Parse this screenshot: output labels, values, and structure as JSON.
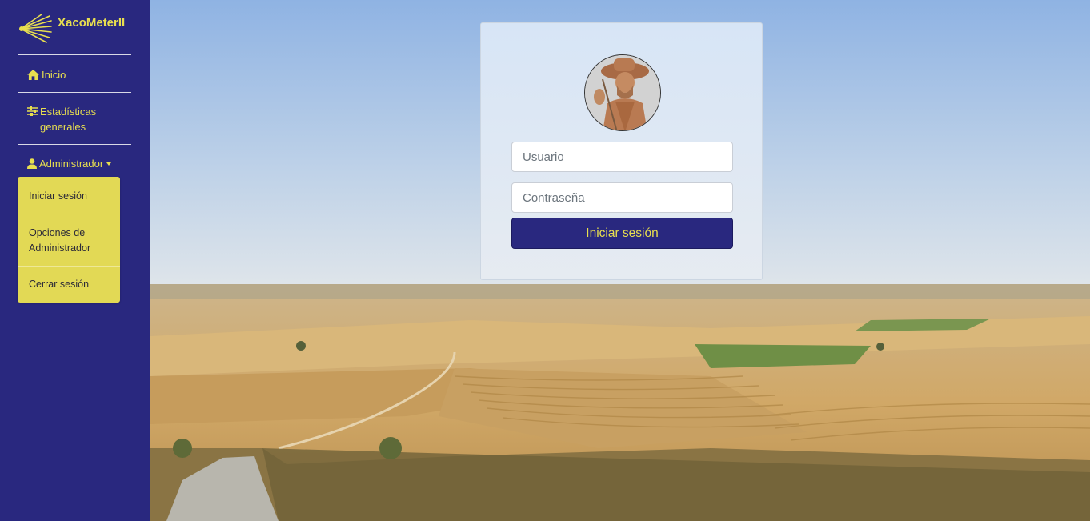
{
  "app": {
    "name": "XacoMeterII"
  },
  "colors": {
    "sidebar": "#29287f",
    "accent": "#e8df4f",
    "dropdown_bg": "#e2d955"
  },
  "sidebar": {
    "items": [
      {
        "label": "Inicio",
        "icon": "home-icon"
      },
      {
        "label": "Estadísticas generales",
        "icon": "sliders-icon"
      },
      {
        "label": "Administrador",
        "icon": "user-icon",
        "has_dropdown": true
      }
    ],
    "dropdown": [
      {
        "label": "Iniciar sesión"
      },
      {
        "label": "Opciones de Administrador"
      },
      {
        "label": "Cerrar sesión"
      }
    ]
  },
  "login": {
    "username_placeholder": "Usuario",
    "username_value": "",
    "password_placeholder": "Contraseña",
    "password_value": "",
    "submit_label": "Iniciar sesión",
    "avatar_icon": "pilgrim-statue-avatar"
  }
}
